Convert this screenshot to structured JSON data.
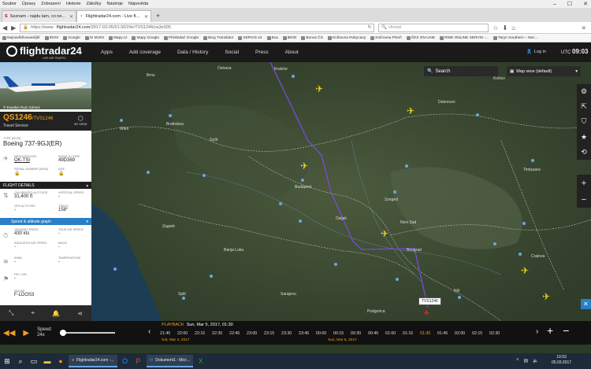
{
  "menu": [
    "Soubor",
    "Úpravy",
    "Zobrazení",
    "Historie",
    "Záložky",
    "Nástroje",
    "Nápověda"
  ],
  "window_controls": [
    "–",
    "☐",
    "✕"
  ],
  "tabs": [
    {
      "label": "Seznam - najdu tam, co ne...",
      "active": false
    },
    {
      "label": "Flightradar24.com - Live fl...",
      "active": true
    }
  ],
  "new_tab": "+",
  "url": {
    "prefix": "https://www.",
    "host": "flightradar24.com",
    "path": "/2017-03-05/01:30/24x/TVS1246/ca3e005"
  },
  "search": {
    "placeholder": "Hledat"
  },
  "bookmarks": [
    "Nejnavštěvovanější",
    "IDOS",
    "Google",
    "IS MUNI",
    "Mapy.cz",
    "Mapy Google",
    "Překladač Google",
    "Bing Translator",
    "SERVIS 24",
    "Eva",
    "iBOD",
    "Bonus ČS",
    "Knihovna Rokycany",
    "Knihovna Plzeň",
    "ČEZ ON-LINE",
    "RWE ONLINE SERVIS -...",
    "Taryn Southern – Nec..."
  ],
  "fr24": {
    "logo": "flightradar24",
    "tagline": "LIVE AIR TRAFFIC",
    "nav": [
      "Apps",
      "Add coverage",
      "Data / History",
      "Social",
      "Press",
      "About"
    ],
    "login": "Log in",
    "utc_label": "UTC",
    "utc_time": "09:03",
    "search_label": "Search",
    "map_view": "Map view (default)"
  },
  "flight": {
    "photo_credit": "© Eusebio Ruiz Gómez",
    "callsign": "QS1246",
    "callsign_alt": "/TVS1246",
    "airline": "Travel Service",
    "view3d": "3D VIEW",
    "type_label": "TYPE",
    "type_code": "(B739)",
    "aircraft": "Boeing 737-9GJ(ER)",
    "registration_label": "REGISTRATION",
    "registration": "OK-TSI",
    "modes_label": "MODE-S CODE",
    "modes": "49D369",
    "serial_label": "SERIAL NUMBER (MSN)",
    "age_label": "AGE",
    "details_label": "FLIGHT DETAILS",
    "cal_alt_label": "CALIBRATED ALTITUDE",
    "cal_alt": "31,400 ft",
    "vspeed_label": "VERTICAL SPEED",
    "vspeed": "-",
    "gps_alt_label": "GPS ALTITUDE",
    "gps_alt": "-",
    "track_label": "TRACK",
    "track": "158°",
    "speed_graph": "Speed & altitude graph",
    "gspeed_label": "GROUND SPEED",
    "gspeed": "430 kts",
    "tas_label": "TRUE AIR SPEED",
    "tas": "-",
    "ias_label": "INDICATED AIR SPEED",
    "ias": "-",
    "mach_label": "MACH",
    "mach": "-",
    "wind_label": "WIND",
    "wind": "-",
    "temp_label": "TEMPERATURE",
    "temp": "-",
    "fir_label": "FIR / UIR",
    "fir": "-",
    "radar_label": "RADAR",
    "radar": "F-LDOS3"
  },
  "map": {
    "track_label": "TVS1246",
    "cities": [
      "Kraków",
      "Ostrava",
      "Brno",
      "Wien",
      "Bratislava",
      "Budapest",
      "Győr",
      "Szeged",
      "Timișoara",
      "Zagreb",
      "Banja Luka",
      "Sarajevo",
      "Beograd",
      "Novi Sad",
      "Osijek",
      "Debrecen",
      "Košice",
      "Podgorica",
      "Niš",
      "Craiova",
      "Split"
    ]
  },
  "playback": {
    "label": "PLAYBACK",
    "datetime": "Sun, Mar 5, 2017, 01:30",
    "speed_label": "Speed:",
    "speed_value": "24x",
    "ticks": [
      "21:45",
      "22:00",
      "22:15",
      "22:30",
      "22:45",
      "23:00",
      "23:15",
      "23:30",
      "23:45",
      "00:00",
      "00:15",
      "00:30",
      "00:45",
      "01:00",
      "01:15",
      "01:30",
      "01:45",
      "02:00",
      "02:15",
      "02:30"
    ],
    "day1": "Sat, Mar 4, 2017",
    "day2": "Sun, Mar 5, 2017"
  },
  "taskbar": {
    "tasks": [
      "Flightradar24.com -...",
      "Dokument1 - Micr..."
    ],
    "time": "10:03",
    "date": "05.03.2017"
  },
  "colors": {
    "accent": "#f0a020",
    "blue": "#2a7fc4",
    "track": "#7a4ad8"
  }
}
